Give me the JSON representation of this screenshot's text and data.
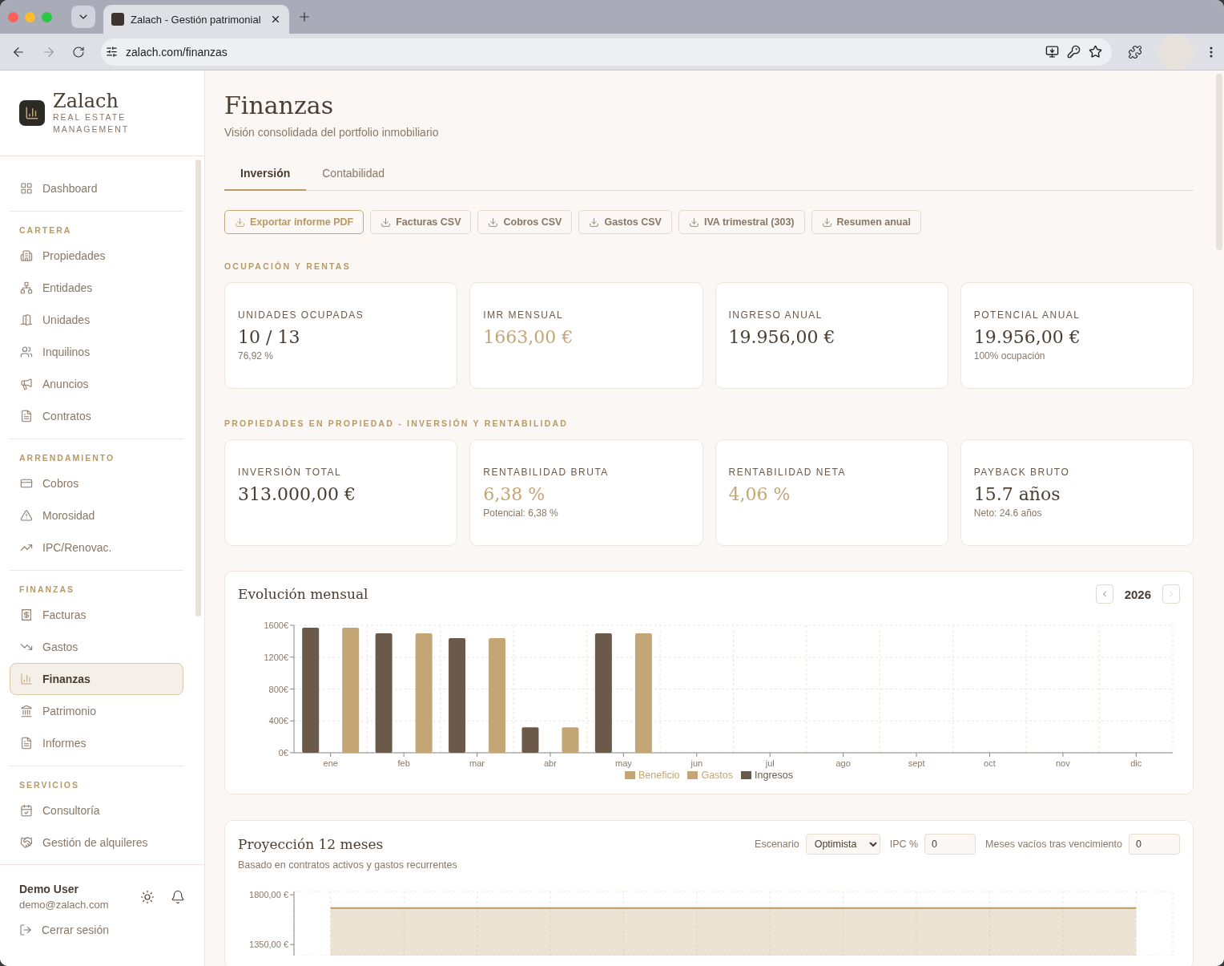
{
  "browser": {
    "tab_title": "Zalach - Gestión patrimonial",
    "url": "zalach.com/finanzas"
  },
  "sidebar": {
    "brand": {
      "name": "Zalach",
      "tagline": "REAL ESTATE MANAGEMENT"
    },
    "top_item": {
      "label": "Dashboard",
      "selected": false
    },
    "sections": [
      {
        "title": "CARTERA",
        "items": [
          {
            "label": "Propiedades",
            "selected": false
          },
          {
            "label": "Entidades",
            "selected": false
          },
          {
            "label": "Unidades",
            "selected": false
          },
          {
            "label": "Inquilinos",
            "selected": false
          },
          {
            "label": "Anuncios",
            "selected": false
          },
          {
            "label": "Contratos",
            "selected": false
          }
        ]
      },
      {
        "title": "ARRENDAMIENTO",
        "items": [
          {
            "label": "Cobros",
            "selected": false
          },
          {
            "label": "Morosidad",
            "selected": false
          },
          {
            "label": "IPC/Renovac.",
            "selected": false
          }
        ]
      },
      {
        "title": "FINANZAS",
        "items": [
          {
            "label": "Facturas",
            "selected": false
          },
          {
            "label": "Gastos",
            "selected": false
          },
          {
            "label": "Finanzas",
            "selected": true
          },
          {
            "label": "Patrimonio",
            "selected": false
          },
          {
            "label": "Informes",
            "selected": false
          }
        ]
      },
      {
        "title": "SERVICIOS",
        "items": [
          {
            "label": "Consultoría",
            "selected": false
          },
          {
            "label": "Gestión de alquileres",
            "selected": false
          }
        ]
      }
    ],
    "user": {
      "name": "Demo User",
      "email": "demo@zalach.com"
    },
    "logout": "Cerrar sesión"
  },
  "page": {
    "title": "Finanzas",
    "subtitle": "Visión consolidada del portfolio inmobiliario"
  },
  "tabs": [
    {
      "label": "Inversión",
      "selected": true
    },
    {
      "label": "Contabilidad",
      "selected": false
    }
  ],
  "exports": [
    {
      "label": "Exportar informe PDF",
      "primary": true
    },
    {
      "label": "Facturas CSV",
      "primary": false
    },
    {
      "label": "Cobros CSV",
      "primary": false
    },
    {
      "label": "Gastos CSV",
      "primary": false
    },
    {
      "label": "IVA trimestral (303)",
      "primary": false
    },
    {
      "label": "Resumen anual",
      "primary": false
    }
  ],
  "kpi_sections": [
    {
      "title": "OCUPACIÓN Y RENTAS",
      "cards": [
        {
          "label": "UNIDADES OCUPADAS",
          "value": "10 / 13",
          "highlight": false,
          "note": "76,92 %"
        },
        {
          "label": "IMR MENSUAL",
          "value": "1663,00 €",
          "highlight": true
        },
        {
          "label": "INGRESO ANUAL",
          "value": "19.956,00 €",
          "highlight": false
        },
        {
          "label": "POTENCIAL ANUAL",
          "value": "19.956,00 €",
          "highlight": false,
          "note": "100% ocupación"
        }
      ]
    },
    {
      "title": "PROPIEDADES EN PROPIEDAD - INVERSIÓN Y RENTABILIDAD",
      "cards": [
        {
          "label": "INVERSIÓN TOTAL",
          "value": "313.000,00 €",
          "highlight": false
        },
        {
          "label": "RENTABILIDAD BRUTA",
          "value": "6,38 %",
          "highlight": true,
          "note": "Potencial: 6,38 %"
        },
        {
          "label": "RENTABILIDAD NETA",
          "value": "4,06 %",
          "highlight": true
        },
        {
          "label": "PAYBACK BRUTO",
          "value": "15.7 años",
          "highlight": false,
          "note": "Neto: 24.6 años"
        }
      ]
    }
  ],
  "monthly": {
    "title": "Evolución mensual",
    "year": "2026",
    "next_disabled": true,
    "chart_data": {
      "type": "bar",
      "grid": true,
      "categories": [
        "ene",
        "feb",
        "mar",
        "abr",
        "may",
        "jun",
        "jul",
        "ago",
        "sept",
        "oct",
        "nov",
        "dic"
      ],
      "ylim": [
        0,
        1600
      ],
      "yticks": [
        {
          "value": 0,
          "label": "0€"
        },
        {
          "value": 400,
          "label": "400€"
        },
        {
          "value": 800,
          "label": "800€"
        },
        {
          "value": 1200,
          "label": "1200€"
        },
        {
          "value": 1600,
          "label": "1600€"
        }
      ],
      "series": [
        {
          "name": "Beneficio",
          "color": "#c4a676",
          "values": [
            1570,
            1500,
            1440,
            320,
            1500,
            0,
            0,
            0,
            0,
            0,
            0,
            0
          ]
        },
        {
          "name": "Gastos",
          "color": "#c4a676",
          "values": [
            0,
            0,
            0,
            0,
            0,
            0,
            0,
            0,
            0,
            0,
            0,
            0
          ]
        },
        {
          "name": "Ingresos",
          "color": "#6b5a4a",
          "values": [
            1570,
            1500,
            1440,
            320,
            1500,
            0,
            0,
            0,
            0,
            0,
            0,
            0
          ]
        }
      ]
    }
  },
  "projection": {
    "title": "Proyección 12 meses",
    "subtitle": "Basado en contratos activos y gastos recurrentes",
    "controls": [
      {
        "kind": "select",
        "label": "Escenario",
        "value": "Optimista"
      },
      {
        "kind": "input",
        "label": "IPC %",
        "value": "0"
      },
      {
        "kind": "input",
        "label": "Meses vacíos tras vencimiento",
        "value": "0"
      }
    ],
    "chart_data": {
      "type": "area",
      "grid": true,
      "categories": [
        null,
        null,
        null,
        null,
        null,
        null,
        null,
        null,
        null,
        null,
        null,
        null
      ],
      "ylim": [
        1250,
        1830
      ],
      "yticks": [
        {
          "value": 1800,
          "label": "1800,00 €"
        },
        {
          "value": 1350,
          "label": "1350,00 €"
        }
      ],
      "series": [
        {
          "color": "#b89a66",
          "values": [
            1680,
            1680,
            1680,
            1680,
            1680,
            1680,
            1680,
            1680,
            1680,
            1680,
            1680,
            1680
          ]
        }
      ]
    }
  }
}
